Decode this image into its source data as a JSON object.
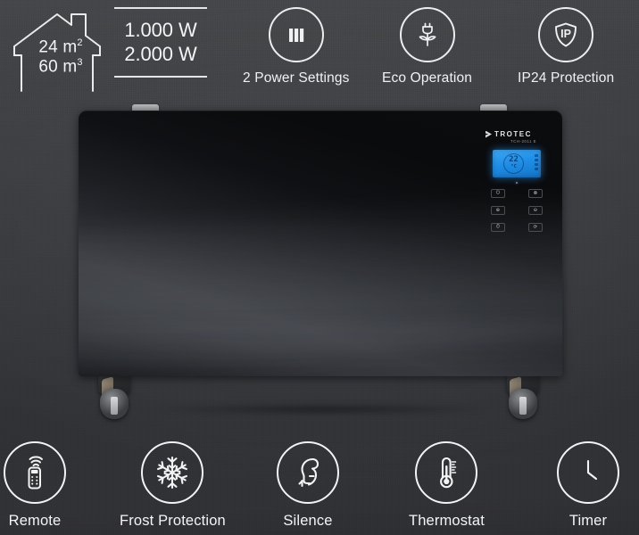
{
  "product": {
    "brand": "TROTEC",
    "model_line": "TCH-2011 E",
    "display": {
      "value": "22",
      "unit": "°C",
      "backlight_color": "#2d97e8"
    },
    "touch_keys": [
      {
        "name": "power-key",
        "glyph": "⏻"
      },
      {
        "name": "mode-key",
        "glyph": "☸"
      },
      {
        "name": "plus-key",
        "glyph": "⊕"
      },
      {
        "name": "minus-key",
        "glyph": "⊖"
      },
      {
        "name": "timer-key",
        "glyph": "⏱"
      },
      {
        "name": "swing-key",
        "glyph": "⟳"
      }
    ]
  },
  "top_features": {
    "house": {
      "area": "24 m",
      "area_sup": "2",
      "volume": "60 m",
      "volume_sup": "3",
      "icon": "house-outline-icon"
    },
    "wattage": {
      "line1": "1.000 W",
      "line2": "2.000 W"
    },
    "items": [
      {
        "label": "2 Power Settings",
        "icon": "power-bars-icon"
      },
      {
        "label": "Eco Operation",
        "icon": "eco-plug-plant-icon"
      },
      {
        "label": "IP24 Protection",
        "icon": "shield-ip-icon",
        "shield_text": "IP"
      }
    ]
  },
  "bottom_features": [
    {
      "label": "Remote",
      "icon": "remote-control-icon"
    },
    {
      "label": "Frost Protection",
      "icon": "snowflake-icon"
    },
    {
      "label": "Silence",
      "icon": "quiet-face-icon"
    },
    {
      "label": "Thermostat",
      "icon": "thermometer-icon"
    },
    {
      "label": "Timer",
      "icon": "clock-icon"
    }
  ],
  "colors": {
    "background_top": "#44464a",
    "background_bottom": "#2c2d31",
    "text": "#f2f3f4",
    "glass_black": "#0b0c0e",
    "lcd_blue": "#2d97e8",
    "bracket_silver": "#b9bbbd"
  }
}
